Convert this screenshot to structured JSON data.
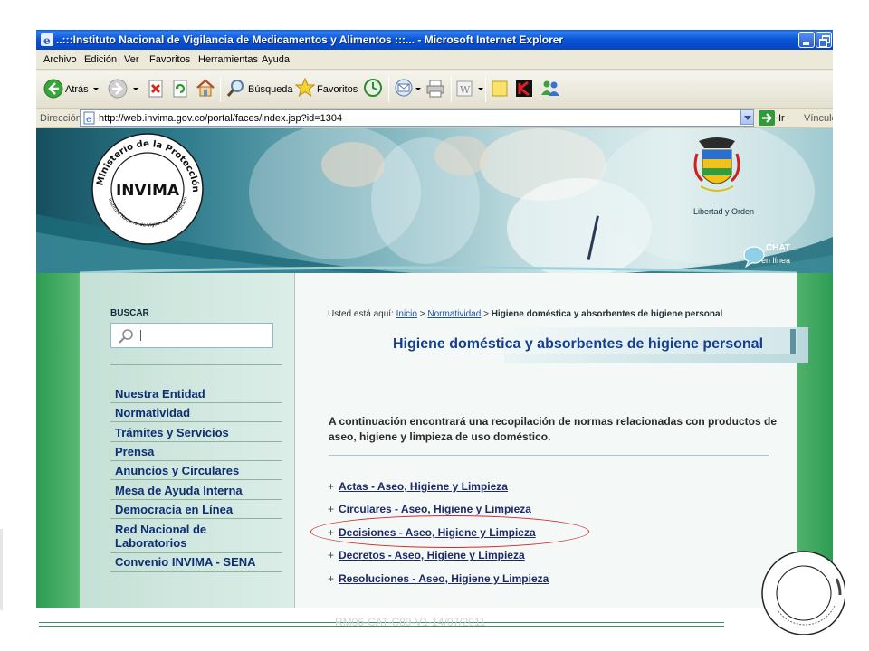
{
  "window": {
    "title": "..:::Instituto Nacional de Vigilancia de Medicamentos y Alimentos :::... - Microsoft Internet Explorer"
  },
  "menu": {
    "items": [
      "Archivo",
      "Edición",
      "Ver",
      "Favoritos",
      "Herramientas",
      "Ayuda"
    ]
  },
  "toolbar": {
    "back_label": "Atrás",
    "search_label": "Búsqueda",
    "favorites_label": "Favoritos"
  },
  "address": {
    "label": "Dirección",
    "url": "http://web.invima.gov.co/portal/faces/index.jsp?id=1304",
    "go_label": "Ir",
    "links_label": "Vínculos"
  },
  "banner": {
    "logo_text": "INVIMA",
    "seal_top_text": "Ministerio de la Protección Social",
    "seal_bottom_text": "Instituto Nacional de Vigilancia de Medicamentos y Alimentos",
    "motto": "Libertad y Orden",
    "chat_label": "CHAT",
    "chat_sub": "en línea"
  },
  "sidebar": {
    "search_heading": "BUSCAR",
    "nav": [
      "Nuestra Entidad",
      "Normatividad",
      "Trámites y Servicios",
      "Prensa",
      "Anuncios y Circulares",
      "Mesa de Ayuda Interna",
      "Democracia en Línea",
      "Red Nacional de Laboratorios",
      "Convenio INVIMA - SENA"
    ]
  },
  "content": {
    "breadcrumb_prefix": "Usted está aquí:",
    "breadcrumb_home": "Inicio",
    "breadcrumb_section": "Normatividad",
    "breadcrumb_current": "Higiene doméstica y absorbentes de higiene personal",
    "heading": "Higiene doméstica y absorbentes de higiene personal",
    "intro": "A continuación encontrará una recopilación de normas relacionadas con productos de aseo, higiene y limpieza de uso doméstico.",
    "links": [
      "Actas - Aseo, Higiene y Limpieza",
      "Circulares - Aseo, Higiene y Limpieza",
      "Decisiones - Aseo, Higiene y Limpieza",
      "Decretos - Aseo, Higiene y Limpieza",
      "Resoluciones - Aseo, Higiene y Limpieza"
    ]
  },
  "footer": {
    "text": "RM06-CAT-C89-V1-14/07/2011"
  },
  "colors": {
    "title_bar": "#0a54d4",
    "nav_link": "#0c2f74",
    "heading": "#143e8f",
    "highlight": "#d22a2a"
  }
}
